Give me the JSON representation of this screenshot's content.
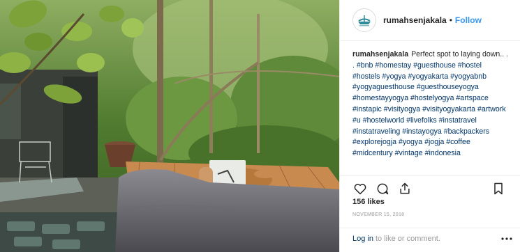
{
  "post": {
    "username": "rumahsenjakala",
    "separator": "•",
    "follow_label": "Follow",
    "avatar_icon": "boat-logo-icon",
    "caption_text": "Perfect spot to laying down.. .",
    "hashtags_line": ". #bnb #homestay #guesthouse #hostel #hostels #yogya #yogyakarta #yogyabnb #yogyaguesthouse #guesthouseyogya #homestayyogya #hostelyogya #artspace #instapic #visityogya #visityogyakarta #artwork #u #hostelworld #livefolks #instatravel #instatraveling #instayogya #backpackers #explorejogja #yogya #jogja #coffee #midcentury #vintage #indonesia",
    "likes": "156 likes",
    "date": "NOVEMBER 15, 2018",
    "login_link": "Log in",
    "login_text": "to like or comment.",
    "icons": [
      "heart-icon",
      "comment-icon",
      "share-icon",
      "bookmark-icon",
      "more-icon"
    ]
  },
  "colors": {
    "link": "#003569",
    "follow": "#3897f0",
    "muted": "#999999"
  }
}
